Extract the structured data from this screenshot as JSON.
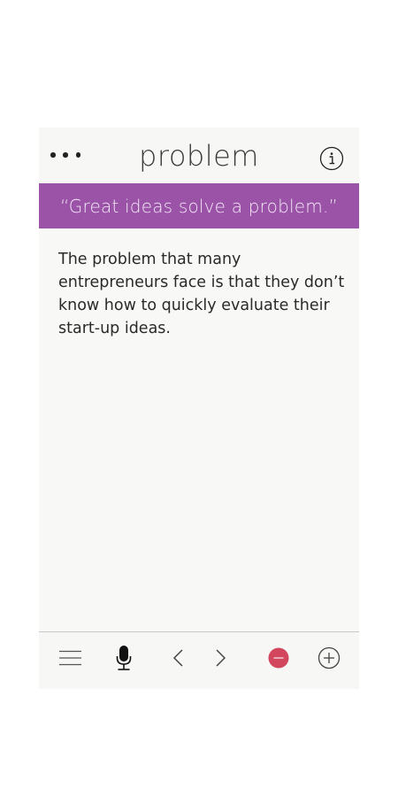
{
  "header": {
    "more_icon": "ellipsis-icon",
    "title": "problem",
    "info_icon": "info-circle-icon"
  },
  "quote": {
    "text": "“Great ideas solve a problem.”",
    "background": "#9a53a7"
  },
  "content": {
    "text": "The problem that many entrepreneurs face is that they don’t know how to quickly evaluate their start-up ideas."
  },
  "toolbar": {
    "buttons": [
      {
        "icon": "menu-icon"
      },
      {
        "icon": "microphone-icon"
      },
      {
        "icon": "chevron-left-icon"
      },
      {
        "icon": "chevron-right-icon"
      },
      {
        "icon": "remove-icon",
        "color": "#d2475e"
      },
      {
        "icon": "add-icon"
      }
    ]
  }
}
